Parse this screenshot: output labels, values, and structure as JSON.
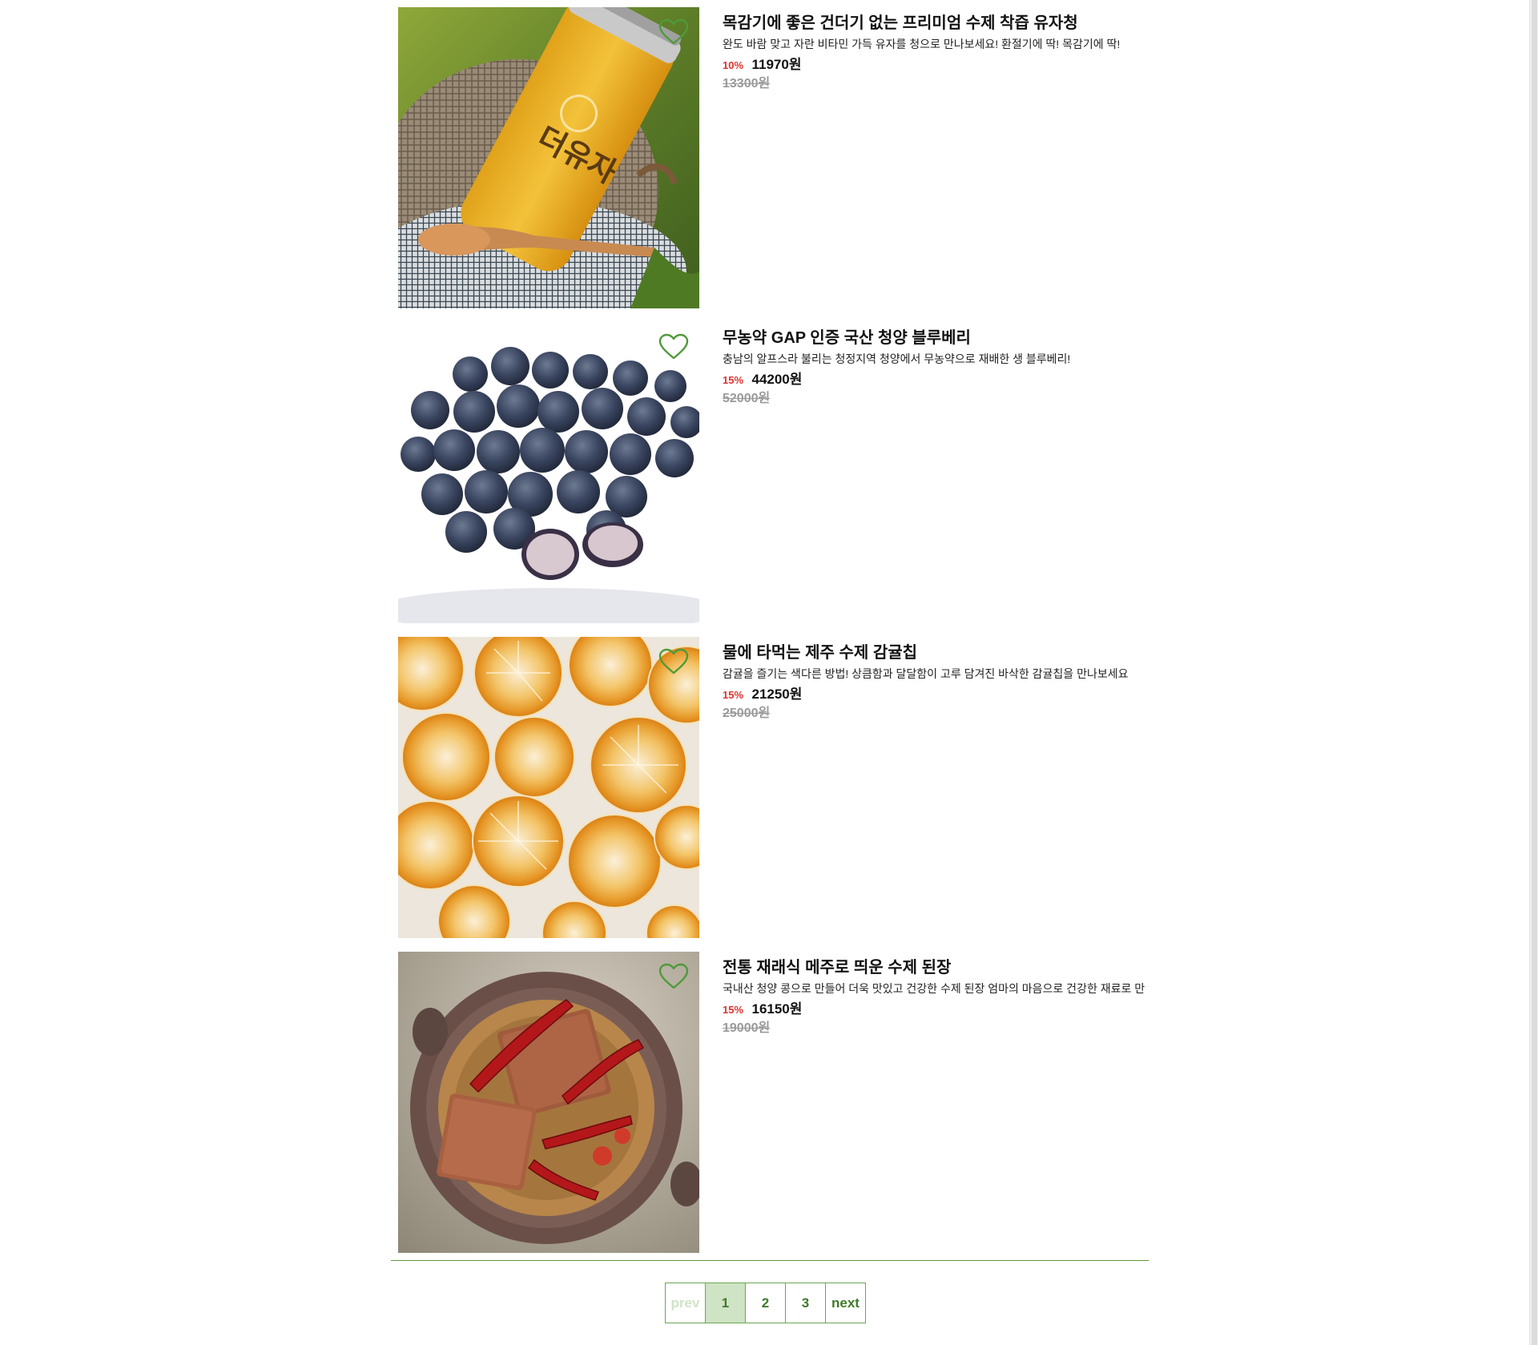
{
  "products": [
    {
      "title": "목감기에 좋은 건더기 없는 프리미엄 수제 착즙 유자청",
      "description": "완도 바람 맞고 자란 비타민 가득 유자를 청으로 만나보세요! 환절기에 딱! 목감기에 딱!",
      "discount_rate": "10%",
      "price": "11970원",
      "original_price": "13300원",
      "image": "yuja-tea-jar",
      "jar_label": "더유자"
    },
    {
      "title": "무농약 GAP 인증 국산 청양 블루베리",
      "description": "충남의 알프스라 불리는 청정지역 청양에서 무농약으로 재배한 생 블루베리!",
      "discount_rate": "15%",
      "price": "44200원",
      "original_price": "52000원",
      "image": "blueberries"
    },
    {
      "title": "물에 타먹는 제주 수제 감귤칩",
      "description": "감귤을 즐기는 색다른 방법! 상큼함과 달달함이 고루 담겨진 바삭한 감귤칩을 만나보세요",
      "discount_rate": "15%",
      "price": "21250원",
      "original_price": "25000원",
      "image": "dried-tangerine-slices"
    },
    {
      "title": "전통 재래식 메주로 띄운 수제 된장",
      "description": "국내산 청양 콩으로 만들어 더욱 맛있고 건강한 수제 된장 엄마의 마음으로 건강한 재료로 만들었습니다",
      "discount_rate": "15%",
      "price": "16150원",
      "original_price": "19000원",
      "image": "doenjang-pot"
    }
  ],
  "pagination": {
    "prev_label": "prev",
    "pages": [
      "1",
      "2",
      "3"
    ],
    "current_page": "1",
    "next_label": "next"
  },
  "colors": {
    "accent_green": "#6aa84f",
    "active_page_bg": "#cfe3c5",
    "discount_red": "#e0312e",
    "original_price_gray": "#9a9a9a"
  }
}
